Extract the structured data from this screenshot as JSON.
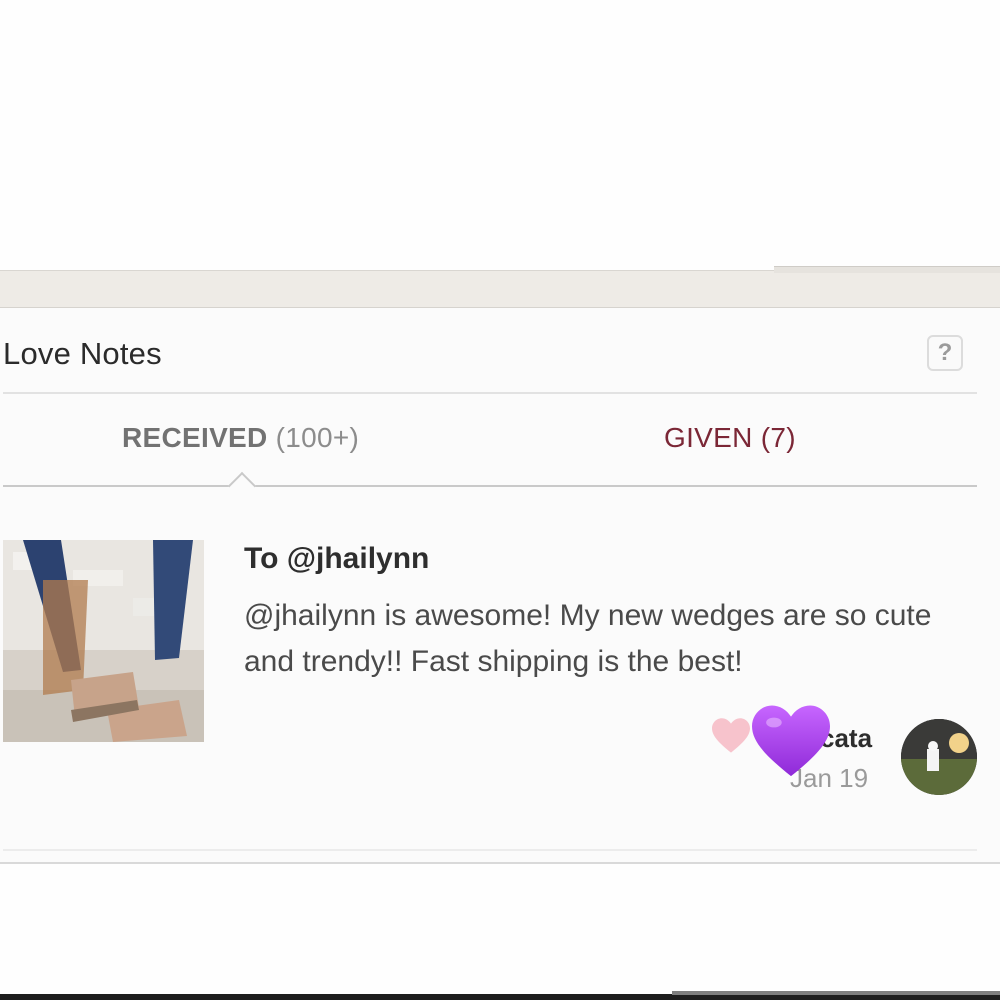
{
  "panel": {
    "title": "Love Notes",
    "help_label": "?"
  },
  "tabs": {
    "received_label": "RECEIVED",
    "received_count": "(100+)",
    "given_label": "GIVEN (7)"
  },
  "note": {
    "to": "To @jhailynn",
    "body": "@jhailynn is awesome! My new wedges are so cute and trendy!! Fast shipping is the best!",
    "author_fragment": "cata",
    "date": "Jan 19",
    "image_icon": "product-photo-wedge-sandals",
    "avatar_icon": "user-avatar-photo"
  },
  "overlay": {
    "small_heart_color": "#f7c3cc",
    "big_heart_color": "#a43de6"
  },
  "colors": {
    "given_tab": "#7b2736",
    "received_tab": "#727272"
  }
}
